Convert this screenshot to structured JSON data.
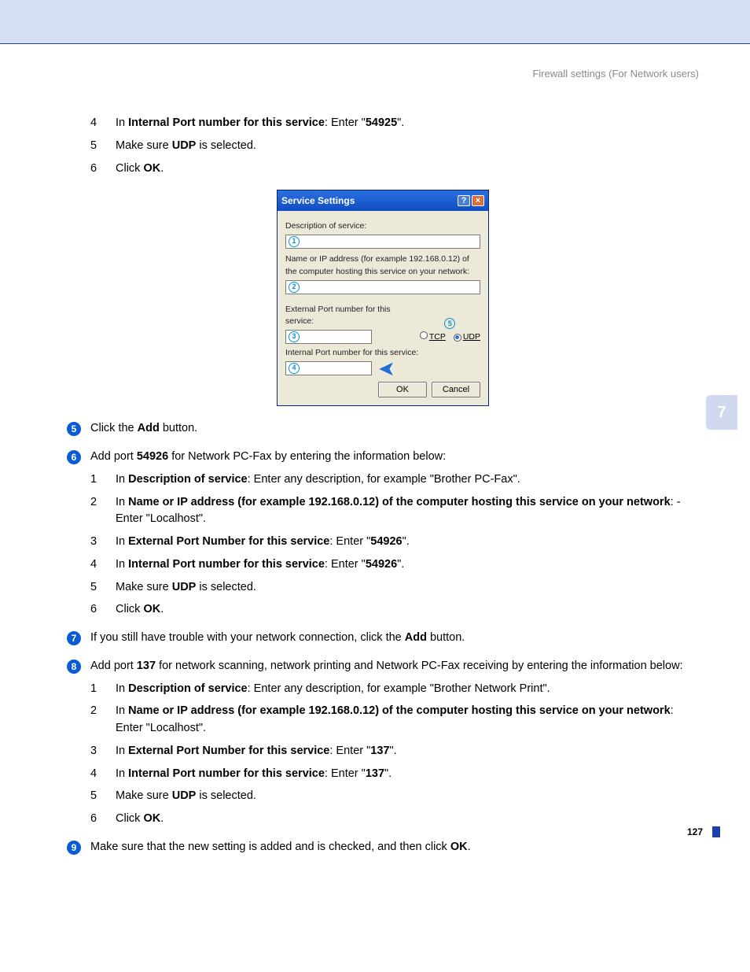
{
  "header": {
    "title": "Firewall settings (For Network users)"
  },
  "side_tab": "7",
  "page_number": "127",
  "intro_sub": [
    {
      "n": "4",
      "pre": "In ",
      "bold": "Internal Port number for this service",
      "mid": ": Enter \"",
      "bold2": "54925",
      "post": "\"."
    },
    {
      "n": "5",
      "pre": "Make sure ",
      "bold": "UDP",
      "post": " is selected."
    },
    {
      "n": "6",
      "pre": "Click ",
      "bold": "OK",
      "post": "."
    }
  ],
  "dialog": {
    "title": "Service Settings",
    "lbl_desc": "Description of service:",
    "lbl_ip": "Name or IP address (for example 192.168.0.12) of the computer hosting this service on your network:",
    "lbl_ext": "External Port number for this service:",
    "lbl_int": "Internal Port number for this service:",
    "tcp": "TCP",
    "udp": "UDP",
    "ok": "OK",
    "cancel": "Cancel"
  },
  "steps": [
    {
      "num": "5",
      "text_parts": [
        "Click the ",
        "Add",
        " button."
      ]
    },
    {
      "num": "6",
      "text_parts": [
        "Add port ",
        "54926",
        " for Network PC-Fax by entering the information below:"
      ],
      "sub": [
        {
          "n": "1",
          "html": "In <b>Description of service</b>: Enter any description, for example \"Brother PC-Fax\"."
        },
        {
          "n": "2",
          "html": "In <b>Name or IP address (for example 192.168.0.12) of the computer hosting this service on your network</b>: - Enter \"Localhost\"."
        },
        {
          "n": "3",
          "html": "In <b>External Port Number for this service</b>: Enter \"<b>54926</b>\"."
        },
        {
          "n": "4",
          "html": "In <b>Internal Port number for this service</b>: Enter \"<b>54926</b>\"."
        },
        {
          "n": "5",
          "html": "Make sure <b>UDP</b> is selected."
        },
        {
          "n": "6",
          "html": "Click <b>OK</b>."
        }
      ]
    },
    {
      "num": "7",
      "text_parts": [
        "If you still have trouble with your network connection, click the ",
        "Add",
        " button."
      ]
    },
    {
      "num": "8",
      "text_parts": [
        "Add port ",
        "137",
        " for network scanning, network printing and Network PC-Fax receiving by entering the information below:"
      ],
      "sub": [
        {
          "n": "1",
          "html": "In <b>Description of service</b>: Enter any description, for example \"Brother Network Print\"."
        },
        {
          "n": "2",
          "html": "In <b>Name or IP address (for example 192.168.0.12) of the computer hosting this service on your network</b>: Enter \"Localhost\"."
        },
        {
          "n": "3",
          "html": "In <b>External Port Number for this service</b>: Enter \"<b>137</b>\"."
        },
        {
          "n": "4",
          "html": "In <b>Internal Port number for this service</b>: Enter \"<b>137</b>\"."
        },
        {
          "n": "5",
          "html": "Make sure <b>UDP</b> is selected."
        },
        {
          "n": "6",
          "html": "Click <b>OK</b>."
        }
      ]
    },
    {
      "num": "9",
      "text_parts": [
        "Make sure that the new setting is added and is checked, and then click ",
        "OK",
        "."
      ]
    }
  ]
}
